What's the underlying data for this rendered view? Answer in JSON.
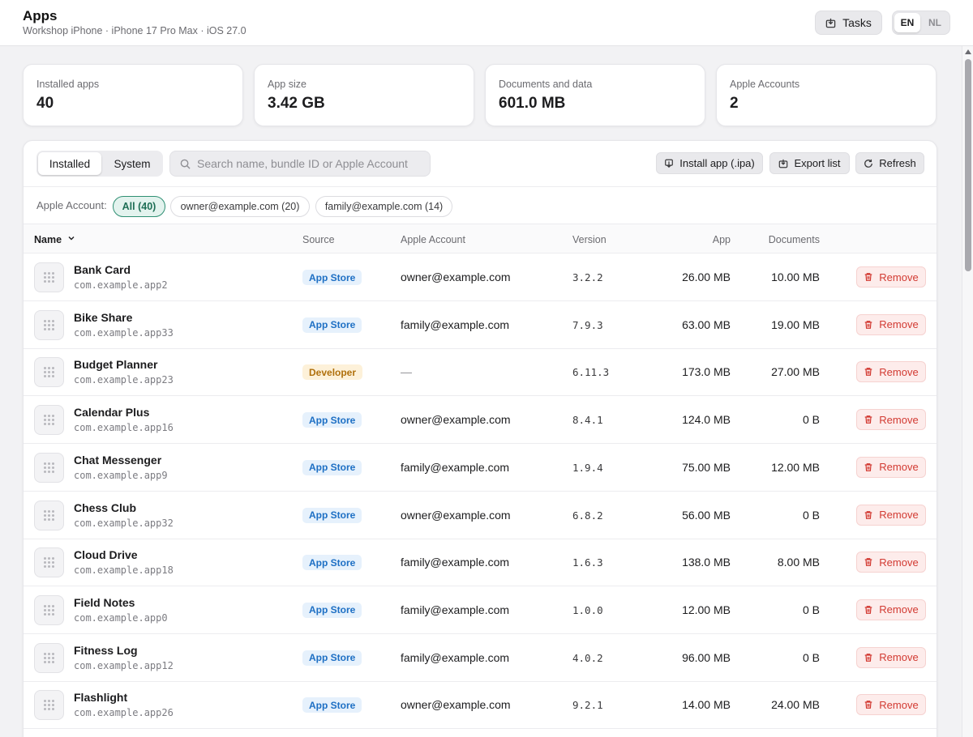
{
  "header": {
    "title": "Apps",
    "subtitle": "Workshop iPhone · iPhone 17 Pro Max · iOS 27.0",
    "tasks_label": "Tasks",
    "languages": [
      "EN",
      "NL"
    ],
    "active_language": "EN"
  },
  "stats": [
    {
      "label": "Installed apps",
      "value": "40"
    },
    {
      "label": "App size",
      "value": "3.42 GB"
    },
    {
      "label": "Documents and data",
      "value": "601.0 MB"
    },
    {
      "label": "Apple Accounts",
      "value": "2"
    }
  ],
  "toolbar": {
    "tabs": [
      "Installed",
      "System"
    ],
    "active_tab": "Installed",
    "search_placeholder": "Search name, bundle ID or Apple Account",
    "install_label": "Install app (.ipa)",
    "export_label": "Export list",
    "refresh_label": "Refresh"
  },
  "filter": {
    "label": "Apple Account:",
    "chips": [
      "All (40)",
      "owner@example.com (20)",
      "family@example.com (14)"
    ],
    "active_chip": "All (40)"
  },
  "table": {
    "columns": {
      "name": "Name",
      "source": "Source",
      "account": "Apple Account",
      "version": "Version",
      "app": "App",
      "documents": "Documents"
    },
    "remove_label": "Remove",
    "rows": [
      {
        "name": "Bank Card",
        "bundle": "com.example.app2",
        "source": "App Store",
        "account": "owner@example.com",
        "version": "3.2.2",
        "app": "26.00 MB",
        "documents": "10.00 MB"
      },
      {
        "name": "Bike Share",
        "bundle": "com.example.app33",
        "source": "App Store",
        "account": "family@example.com",
        "version": "7.9.3",
        "app": "63.00 MB",
        "documents": "19.00 MB"
      },
      {
        "name": "Budget Planner",
        "bundle": "com.example.app23",
        "source": "Developer",
        "account": "—",
        "version": "6.11.3",
        "app": "173.0 MB",
        "documents": "27.00 MB"
      },
      {
        "name": "Calendar Plus",
        "bundle": "com.example.app16",
        "source": "App Store",
        "account": "owner@example.com",
        "version": "8.4.1",
        "app": "124.0 MB",
        "documents": "0 B"
      },
      {
        "name": "Chat Messenger",
        "bundle": "com.example.app9",
        "source": "App Store",
        "account": "family@example.com",
        "version": "1.9.4",
        "app": "75.00 MB",
        "documents": "12.00 MB"
      },
      {
        "name": "Chess Club",
        "bundle": "com.example.app32",
        "source": "App Store",
        "account": "owner@example.com",
        "version": "6.8.2",
        "app": "56.00 MB",
        "documents": "0 B"
      },
      {
        "name": "Cloud Drive",
        "bundle": "com.example.app18",
        "source": "App Store",
        "account": "family@example.com",
        "version": "1.6.3",
        "app": "138.0 MB",
        "documents": "8.00 MB"
      },
      {
        "name": "Field Notes",
        "bundle": "com.example.app0",
        "source": "App Store",
        "account": "family@example.com",
        "version": "1.0.0",
        "app": "12.00 MB",
        "documents": "0 B"
      },
      {
        "name": "Fitness Log",
        "bundle": "com.example.app12",
        "source": "App Store",
        "account": "family@example.com",
        "version": "4.0.2",
        "app": "96.00 MB",
        "documents": "0 B"
      },
      {
        "name": "Flashlight",
        "bundle": "com.example.app26",
        "source": "App Store",
        "account": "owner@example.com",
        "version": "9.2.1",
        "app": "14.00 MB",
        "documents": "24.00 MB"
      }
    ]
  }
}
